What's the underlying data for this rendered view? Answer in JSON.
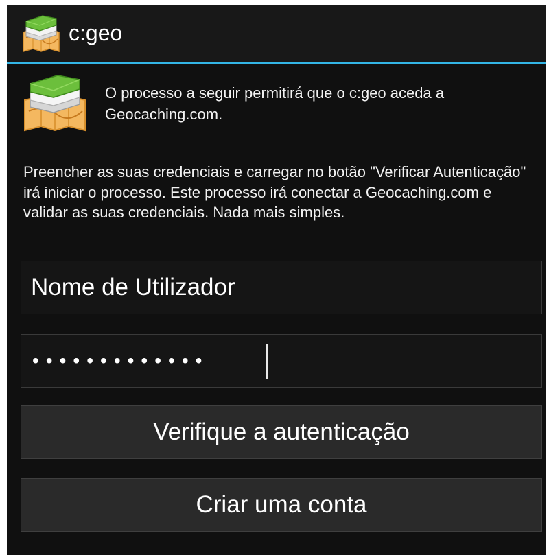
{
  "app": {
    "title": "c:geo",
    "icon": "cgeo-map-book-icon"
  },
  "intro": {
    "icon": "cgeo-map-book-icon",
    "text": "O processo a seguir permitirá que o c:geo aceda a Geocaching.com."
  },
  "description": "Preencher as suas credenciais e carregar no botão \"Verificar Autenticação\" irá iniciar o processo. Este processo irá conectar a Geocaching.com e validar as suas credenciais. Nada mais simples.",
  "form": {
    "username_placeholder": "Nome de Utilizador",
    "username_value": "",
    "password_masked": "•••••••••••••"
  },
  "buttons": {
    "verify": "Verifique a autenticação",
    "create_account": "Criar uma conta"
  },
  "colors": {
    "accent": "#33b5e5",
    "background": "#101010",
    "button": "#2a2a2a"
  }
}
